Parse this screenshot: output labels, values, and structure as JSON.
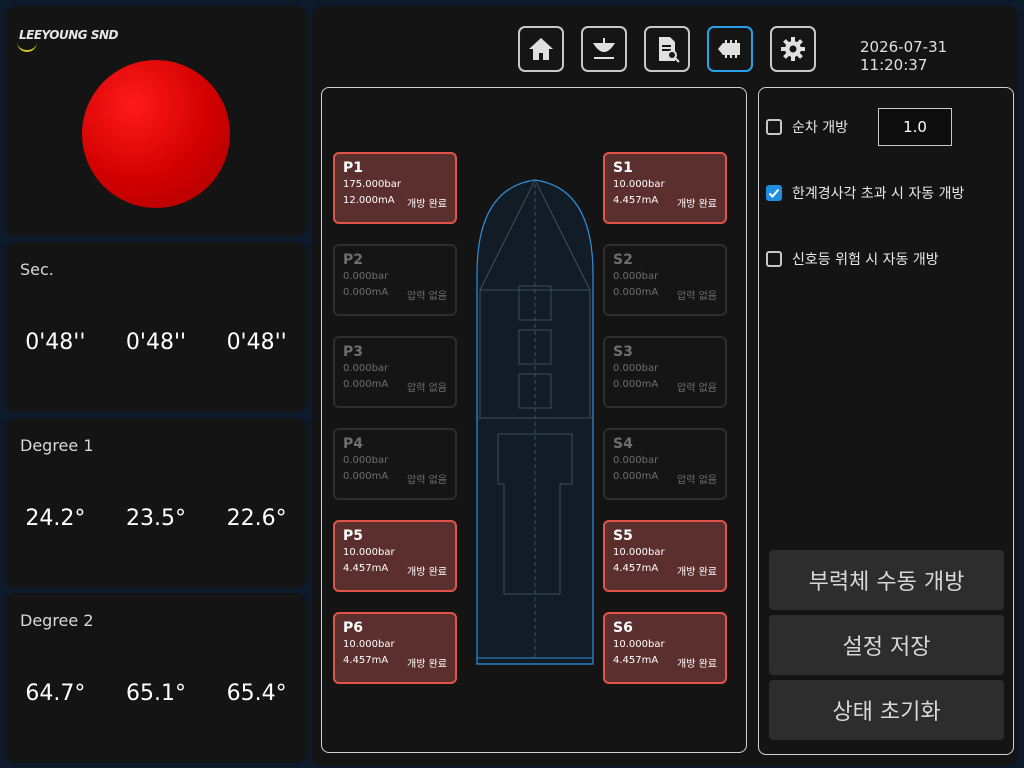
{
  "logo": {
    "text": "LEEYOUNG SND"
  },
  "colors": {
    "warning_light": "#e00000",
    "active_accent": "#27a2e8",
    "valve_done_fill": "#5c2f2f",
    "valve_done_border": "#e0544a"
  },
  "sec": {
    "title": "Sec.",
    "values": [
      "0'48''",
      "0'48''",
      "0'48''"
    ]
  },
  "degree1": {
    "title": "Degree 1",
    "values": [
      "24.2°",
      "23.5°",
      "22.6°"
    ]
  },
  "degree2": {
    "title": "Degree 2",
    "values": [
      "64.7°",
      "65.1°",
      "65.4°"
    ]
  },
  "toolbar": {
    "icons": [
      "home-icon",
      "buoy-icon",
      "report-icon",
      "vessel-icon",
      "gear-icon"
    ],
    "active": "vessel-icon"
  },
  "datetime": "2026-07-31 11:20:37",
  "valves": {
    "port": [
      {
        "name": "P1",
        "pressure": "175.000bar",
        "current": "12.000mA",
        "status": "개방 완료"
      },
      {
        "name": "P2",
        "pressure": "0.000bar",
        "current": "0.000mA",
        "status": "압력 없음"
      },
      {
        "name": "P3",
        "pressure": "0.000bar",
        "current": "0.000mA",
        "status": "압력 없음"
      },
      {
        "name": "P4",
        "pressure": "0.000bar",
        "current": "0.000mA",
        "status": "압력 없음"
      },
      {
        "name": "P5",
        "pressure": "10.000bar",
        "current": "4.457mA",
        "status": "개방 완료"
      },
      {
        "name": "P6",
        "pressure": "10.000bar",
        "current": "4.457mA",
        "status": "개방 완료"
      }
    ],
    "starboard": [
      {
        "name": "S1",
        "pressure": "10.000bar",
        "current": "4.457mA",
        "status": "개방 완료"
      },
      {
        "name": "S2",
        "pressure": "0.000bar",
        "current": "0.000mA",
        "status": "압력 없음"
      },
      {
        "name": "S3",
        "pressure": "0.000bar",
        "current": "0.000mA",
        "status": "압력 없음"
      },
      {
        "name": "S4",
        "pressure": "0.000bar",
        "current": "0.000mA",
        "status": "압력 없음"
      },
      {
        "name": "S5",
        "pressure": "10.000bar",
        "current": "4.457mA",
        "status": "개방 완료"
      },
      {
        "name": "S6",
        "pressure": "10.000bar",
        "current": "4.457mA",
        "status": "개방 완료"
      }
    ]
  },
  "settings": {
    "sequential_label": "순차 개방",
    "sequential_checked": false,
    "interval_value": "1.0",
    "limit_label": "한계경사각 초과 시 자동 개방",
    "limit_checked": true,
    "signal_label": "신호등 위험 시 자동 개방",
    "signal_checked": false
  },
  "actions": {
    "manual_open": "부력체 수동 개방",
    "save": "설정 저장",
    "reset": "상태 초기화"
  }
}
